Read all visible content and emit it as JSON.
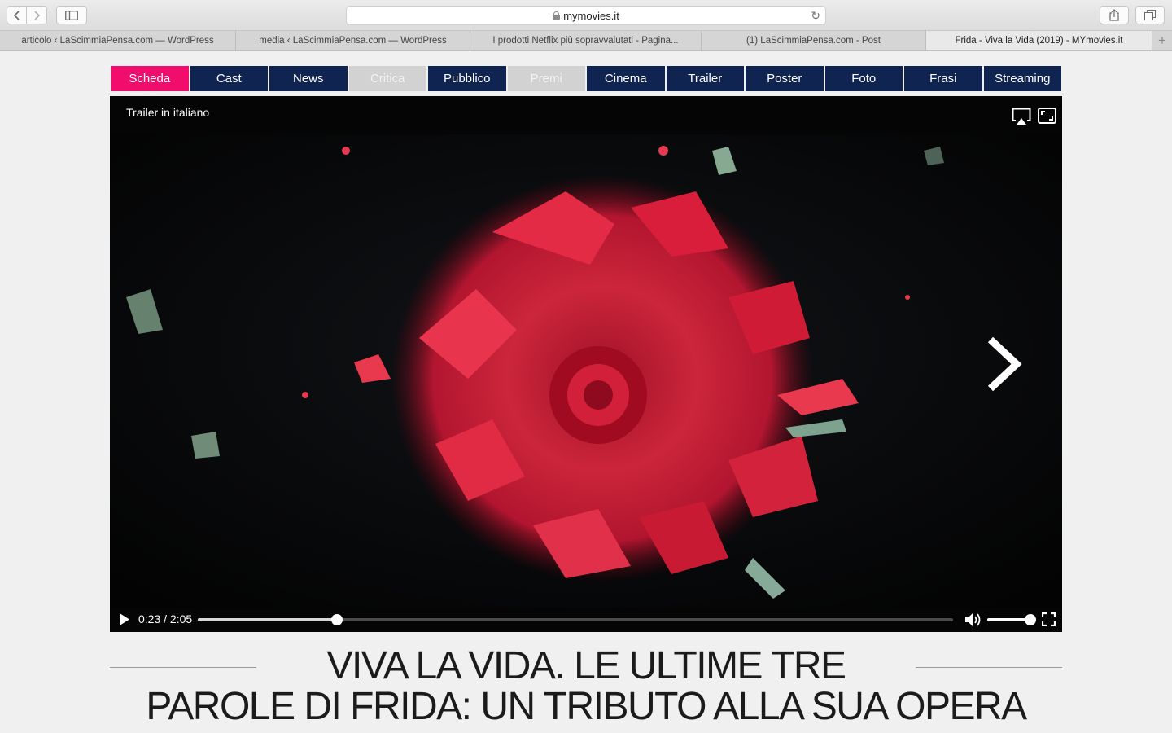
{
  "browser": {
    "address": "mymovies.it",
    "tabs": [
      {
        "label": "articolo ‹ LaScimmiaPensa.com — WordPress",
        "active": false
      },
      {
        "label": "media ‹ LaScimmiaPensa.com — WordPress",
        "active": false
      },
      {
        "label": "I prodotti Netflix più sopravvalutati - Pagina...",
        "active": false
      },
      {
        "label": "(1) LaScimmiaPensa.com - Post",
        "active": false
      },
      {
        "label": "Frida - Viva la Vida (2019) - MYmovies.it",
        "active": true
      }
    ],
    "icons": {
      "back": "chevron-left-icon",
      "forward": "chevron-right-icon",
      "sidebar": "sidebar-icon",
      "lock": "lock-icon",
      "reload": "reload-icon",
      "share": "share-icon",
      "tabs": "tabs-overview-icon",
      "new_tab": "plus-icon"
    }
  },
  "menu": {
    "items": [
      {
        "label": "Scheda",
        "state": "active"
      },
      {
        "label": "Cast",
        "state": "normal"
      },
      {
        "label": "News",
        "state": "normal"
      },
      {
        "label": "Critica",
        "state": "disabled"
      },
      {
        "label": "Pubblico",
        "state": "normal"
      },
      {
        "label": "Premi",
        "state": "disabled"
      },
      {
        "label": "Cinema",
        "state": "normal"
      },
      {
        "label": "Trailer",
        "state": "normal"
      },
      {
        "label": "Poster",
        "state": "normal"
      },
      {
        "label": "Foto",
        "state": "normal"
      },
      {
        "label": "Frasi",
        "state": "normal"
      },
      {
        "label": "Streaming",
        "state": "normal"
      }
    ],
    "colors": {
      "normal": "#0f2451",
      "active": "#f00d6b",
      "disabled": "#d2d2d2"
    }
  },
  "player": {
    "title": "Trailer in italiano",
    "time": "0:23 / 2:05",
    "progress": 0.184,
    "volume": 1.0,
    "icons": [
      "airplay-icon",
      "expand-icon",
      "next-arrow-icon",
      "play-icon",
      "volume-icon",
      "fullscreen-icon"
    ]
  },
  "headline": {
    "line1": "VIVA LA VIDA. LE ULTIME TRE",
    "line2": "PAROLE DI FRIDA: UN TRIBUTO ALLA SUA OPERA"
  }
}
